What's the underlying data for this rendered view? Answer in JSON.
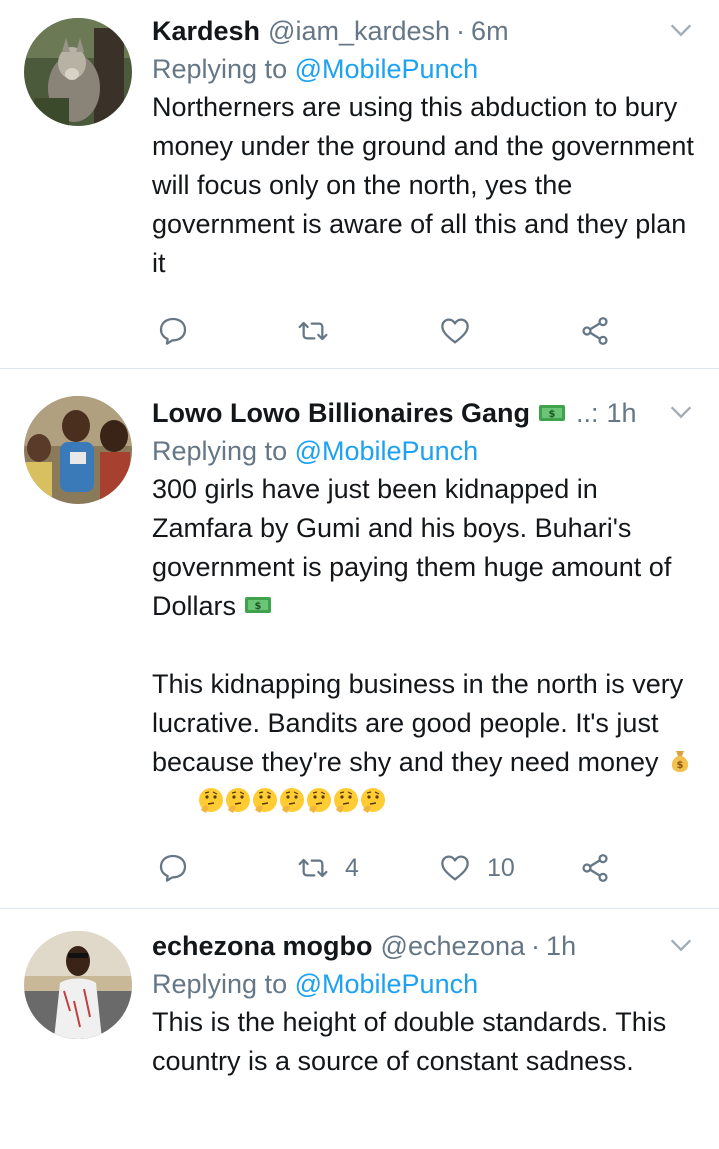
{
  "colors": {
    "link": "#1da1f2",
    "muted": "#657786",
    "text": "#14171a",
    "divider": "#e1e8ed"
  },
  "tweets": [
    {
      "name": "Kardesh",
      "handle": "@iam_kardesh",
      "separator": "·",
      "time": "6m",
      "replying_prefix": "Replying to ",
      "replying_to": "@MobilePunch",
      "text": "Northerners are using this abduction to bury money under the ground and the government will focus only on the north, yes the government is aware of all this and they plan it",
      "retweets": "",
      "likes": ""
    },
    {
      "name": "Lowo Lowo Billionaires Gang",
      "name_emoji": "dollar-banknote-emoji",
      "handle": "..:",
      "time": "1h",
      "replying_prefix": "Replying to ",
      "replying_to": "@MobilePunch",
      "text_p1": "300 girls have just been kidnapped in Zamfara by Gumi and his boys. Buhari's government is paying them huge amount of Dollars",
      "text_p2": "This kidnapping business in the north is very lucrative. Bandits are good people. It's just because they're shy and they need money",
      "emojis": [
        "money-bag-emoji",
        "thinking-face-emoji",
        "thinking-face-emoji",
        "thinking-face-emoji",
        "thinking-face-emoji",
        "thinking-face-emoji",
        "thinking-face-emoji",
        "thinking-face-emoji"
      ],
      "retweets": "4",
      "likes": "10"
    },
    {
      "name": "echezona mogbo",
      "handle": "@echezona",
      "separator": "·",
      "time": "1h",
      "replying_prefix": "Replying to ",
      "replying_to": "@MobilePunch",
      "text": "This is the height of double standards. This country is a source of constant sadness."
    }
  ]
}
